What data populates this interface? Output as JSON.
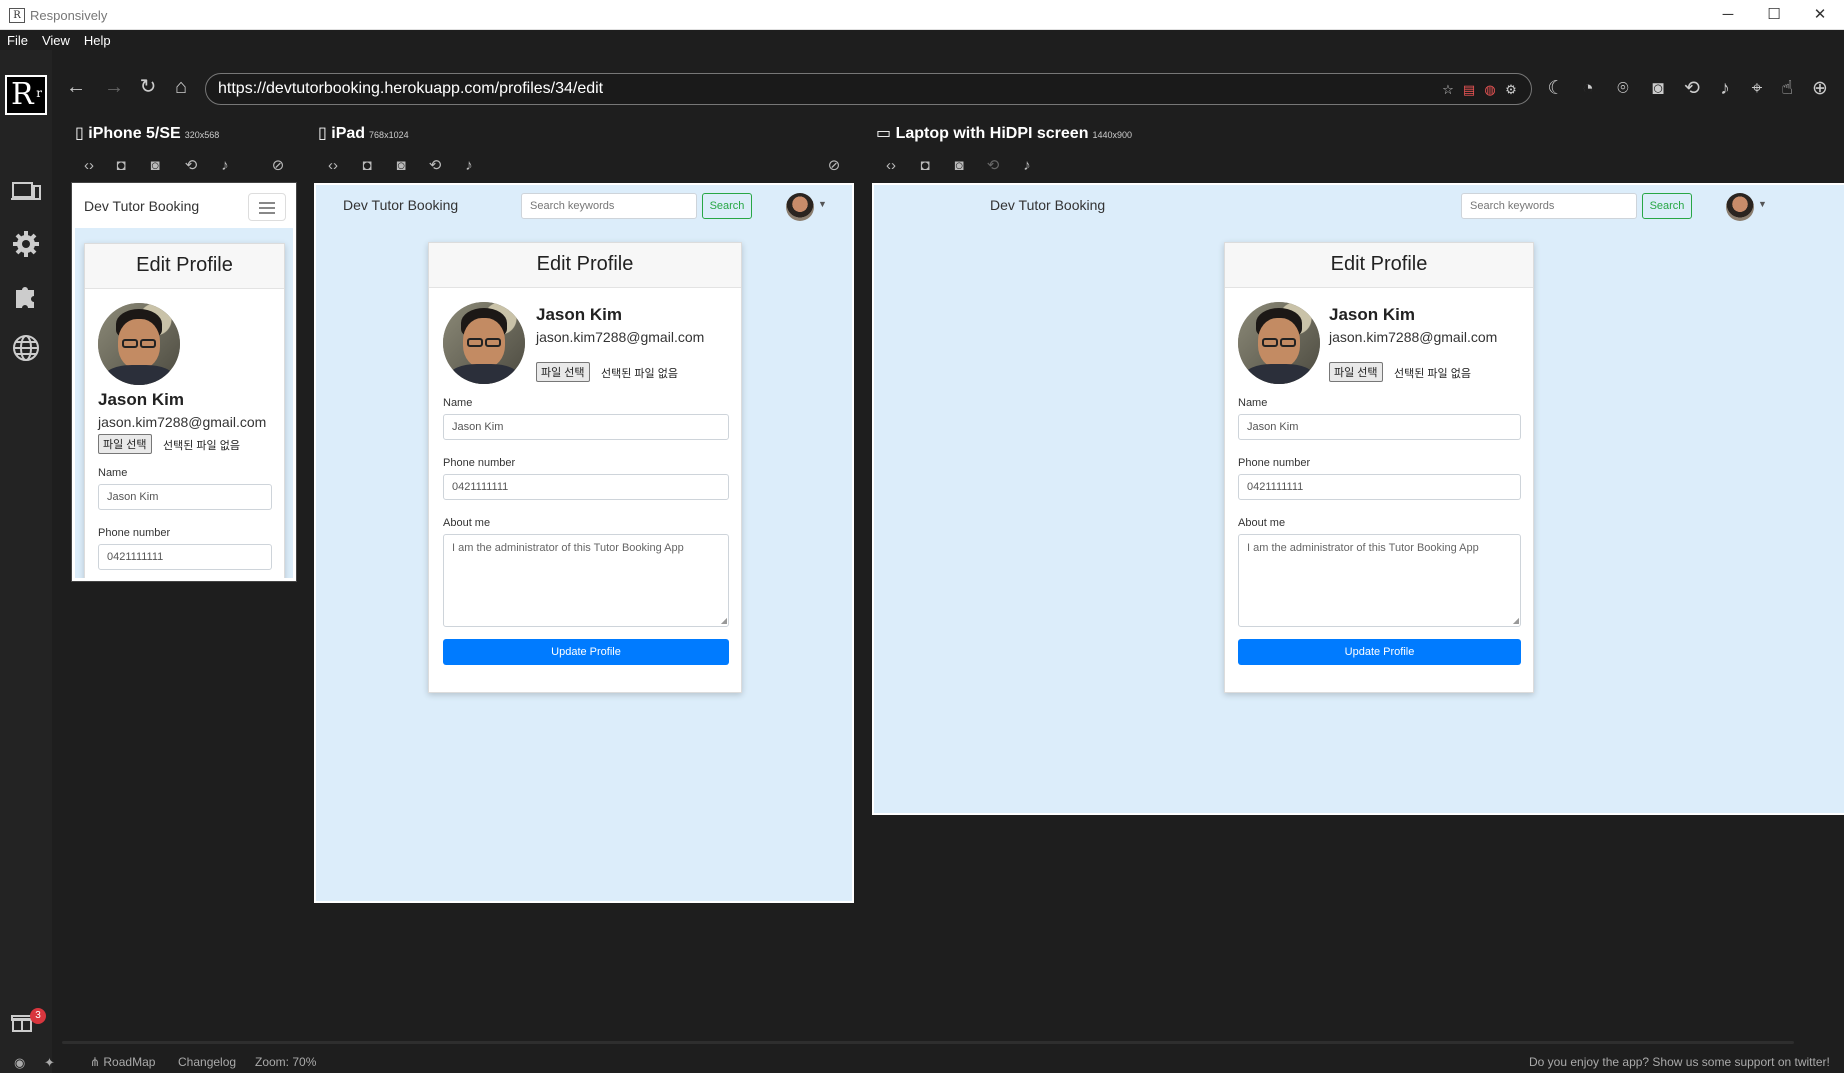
{
  "window": {
    "title": "Responsively",
    "logo": "R",
    "minimize": "─",
    "maximize": "☐",
    "close": "✕"
  },
  "menu": [
    "File",
    "View",
    "Help"
  ],
  "address": {
    "url": "https://devtutorbooking.herokuapp.com/profiles/34/edit"
  },
  "sidebar": {
    "notification_count": "3"
  },
  "devices": [
    {
      "name": "iPhone 5/SE",
      "dims": "320x568"
    },
    {
      "name": "iPad",
      "dims": "768x1024"
    },
    {
      "name": "Laptop with HiDPI screen",
      "dims": "1440x900"
    }
  ],
  "page": {
    "brand": "Dev Tutor Booking",
    "search_placeholder": "Search keywords",
    "search_button": "Search",
    "card_title": "Edit Profile",
    "user_name": "Jason Kim",
    "user_email": "jason.kim7288@gmail.com",
    "file_button": "파일 선택",
    "file_status": "선택된 파일 없음",
    "name_label": "Name",
    "name_value": "Jason Kim",
    "phone_label": "Phone number",
    "phone_value": "0421111111",
    "about_label": "About me",
    "about_value": "I am the administrator of this Tutor Booking App",
    "update_button": "Update Profile"
  },
  "footer": {
    "roadmap": "RoadMap",
    "changelog": "Changelog",
    "zoom": "Zoom: 70%",
    "support": "Do you enjoy the app? Show us some support on twitter!"
  },
  "colors": {
    "viewport_bg": "#dcedfa",
    "primary": "#007bff",
    "success": "#28a745"
  }
}
